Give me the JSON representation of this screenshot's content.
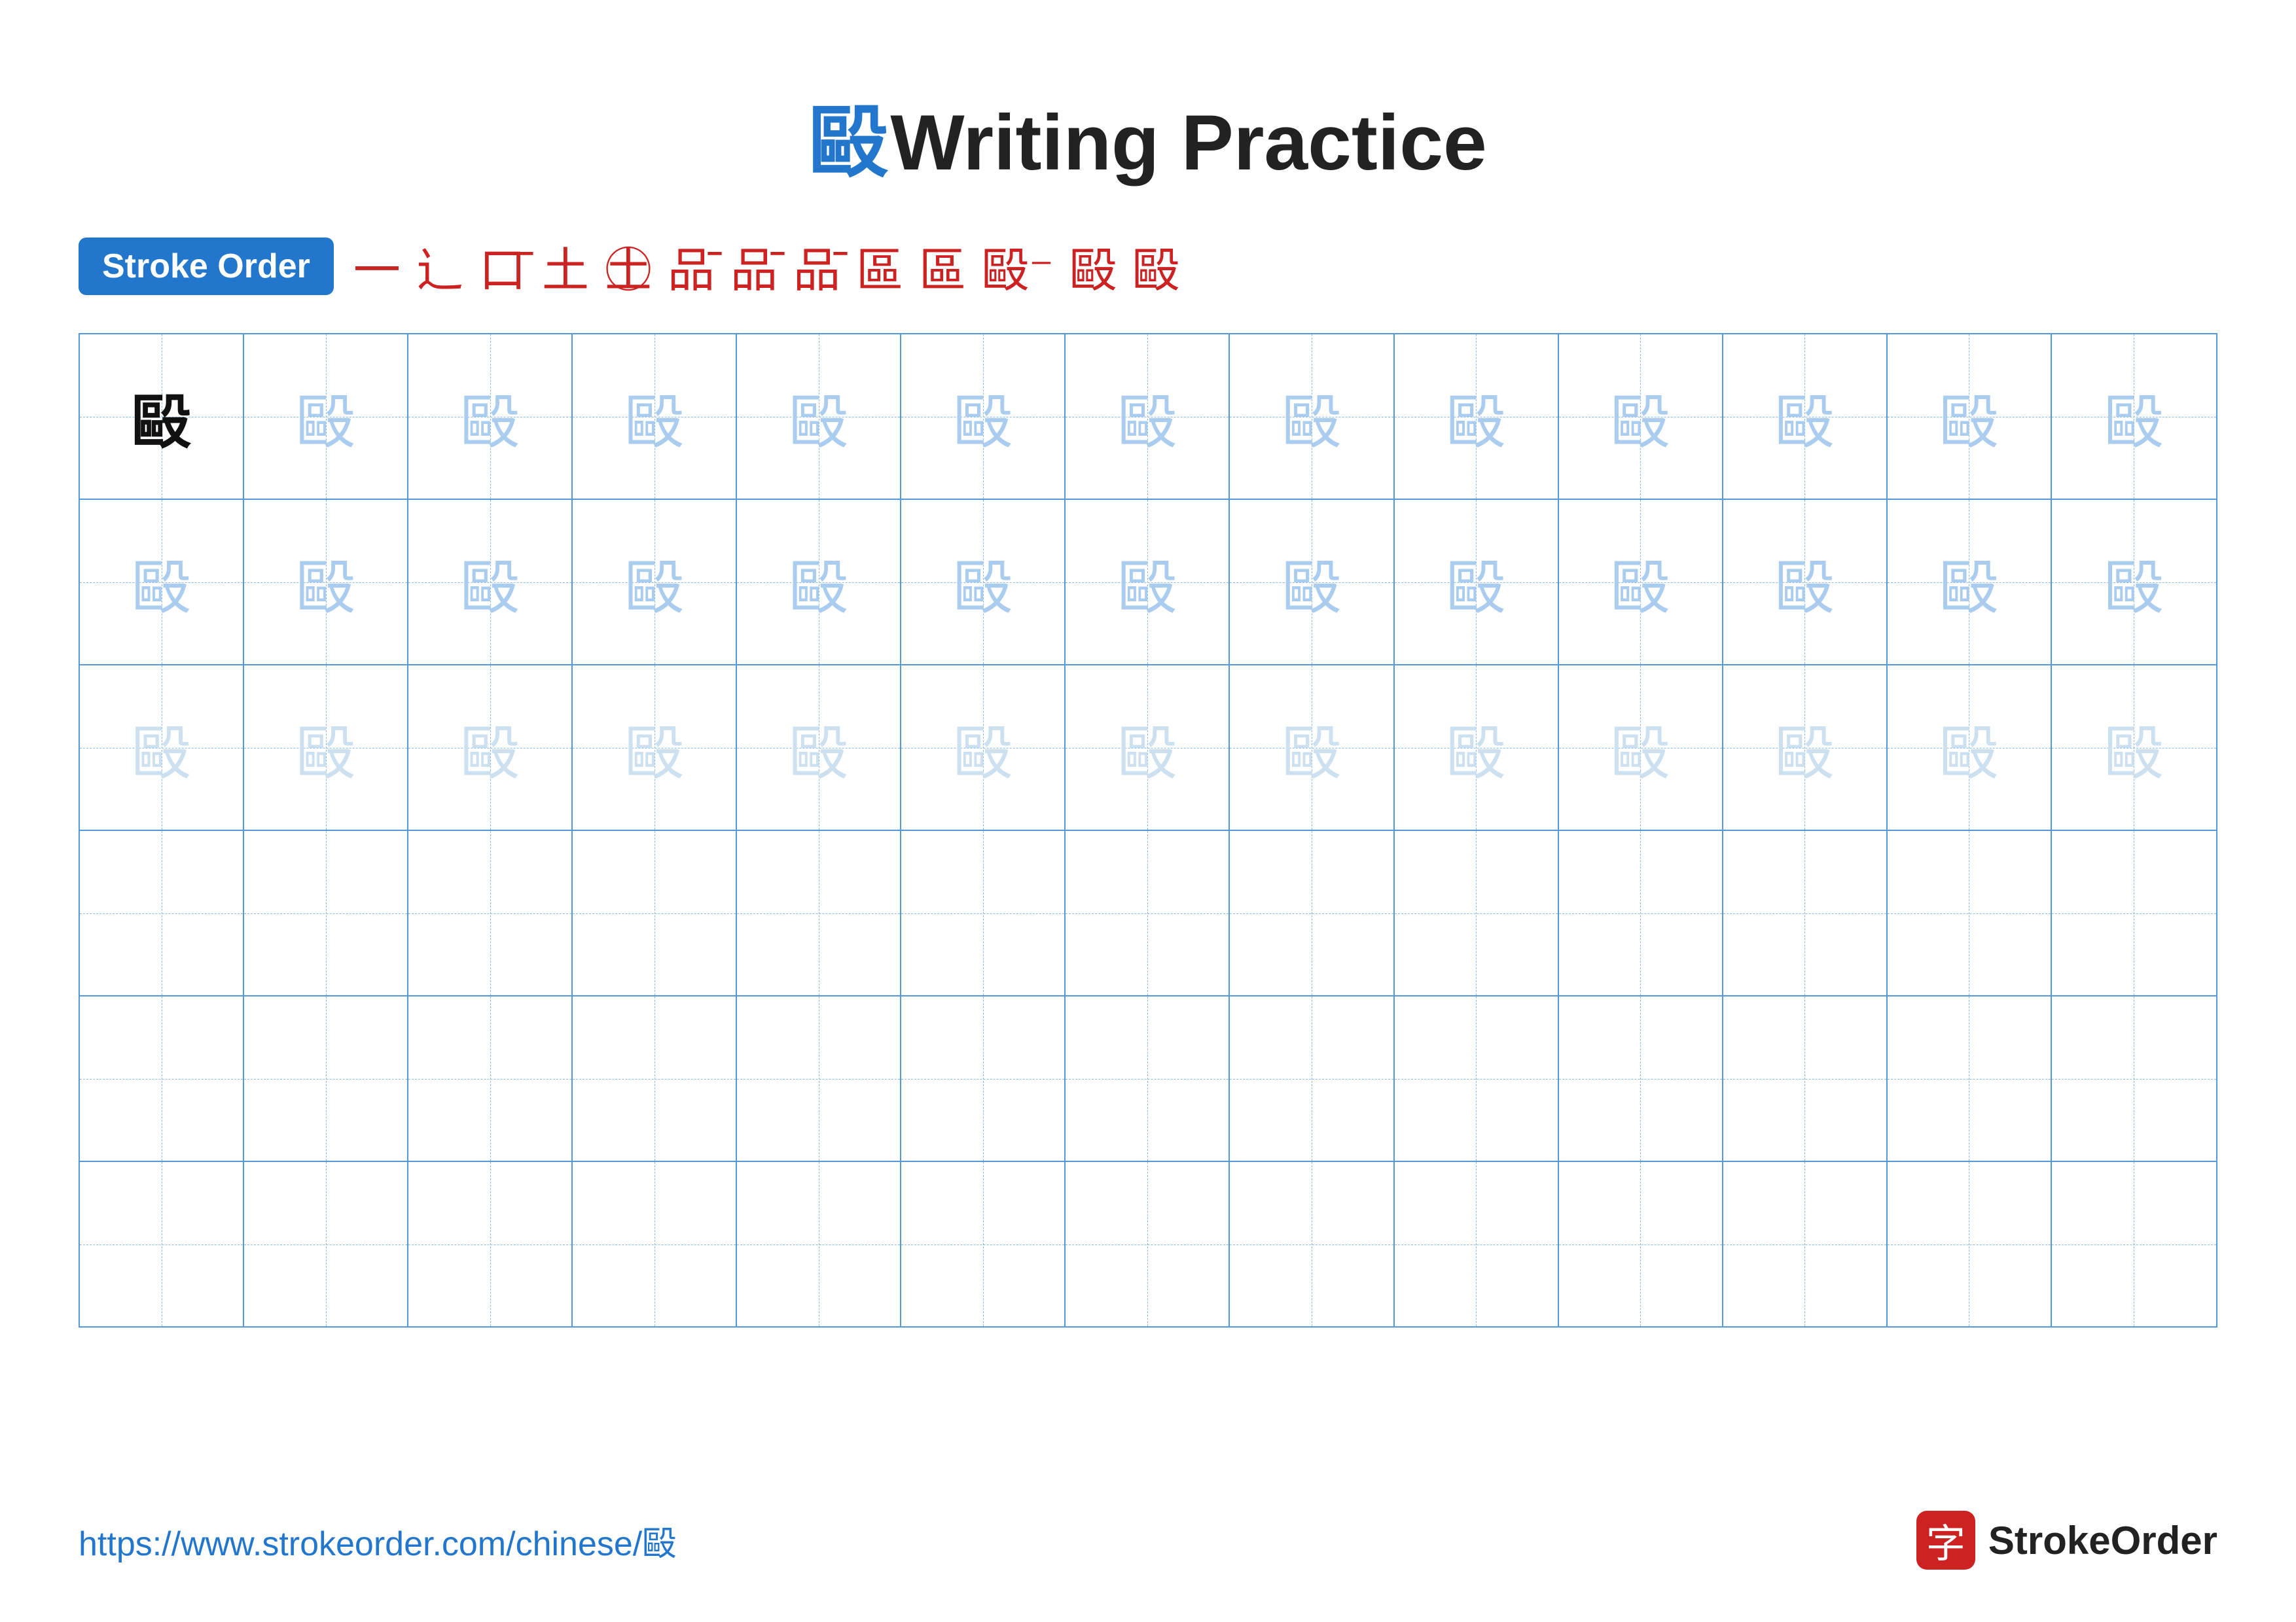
{
  "title": {
    "char": "毆",
    "text": " Writing Practice"
  },
  "stroke_order": {
    "badge_label": "Stroke Order",
    "steps": [
      "一",
      "⻌",
      "⼝",
      "⼟",
      "⼟⼝",
      "⼟⼝一",
      "⼟⼝⼆",
      "⼟⼝⼆⼀",
      "⼟⼝⼱",
      "⼠⼝⼱",
      "⼠⼲⼱",
      "⼠⼲⼱⼄",
      "毆⼄",
      "毆"
    ]
  },
  "character": "毆",
  "grid": {
    "rows": 6,
    "cols": 13,
    "row_types": [
      "dark",
      "medium",
      "light",
      "empty",
      "empty",
      "empty"
    ]
  },
  "footer": {
    "url": "https://www.strokeorder.com/chinese/毆",
    "brand_name": "StrokeOrder",
    "brand_icon": "字"
  }
}
